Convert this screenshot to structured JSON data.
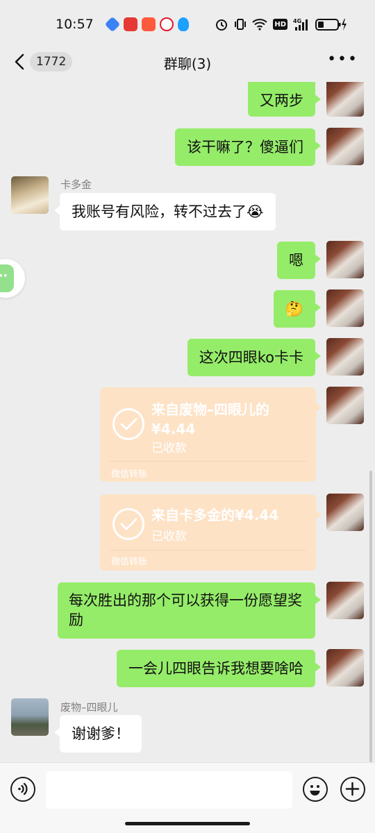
{
  "status_bar": {
    "time": "10:57",
    "hd_label": "HD",
    "network_label": "4G"
  },
  "header": {
    "back_count": "1772",
    "title": "群聊(3)",
    "more_label": "•••"
  },
  "messages": [
    {
      "side": "out",
      "text": "又两步"
    },
    {
      "side": "out",
      "text": "该干嘛了？傻逼们"
    },
    {
      "side": "in",
      "sender": "卡多金",
      "text": "我账号有风险，转不过去了😭"
    },
    {
      "side": "out",
      "text": "嗯"
    },
    {
      "side": "out",
      "text": "🤔"
    },
    {
      "side": "out",
      "text": "这次四眼ko卡卡"
    },
    {
      "side": "out",
      "type": "transfer",
      "title": "来自废物–四眼儿的",
      "amount": "¥4.44",
      "status": "已收款",
      "footer": "微信转账"
    },
    {
      "side": "out",
      "type": "transfer",
      "title": "来自卡多金的¥4.44",
      "status": "已收款",
      "footer": "微信转账"
    },
    {
      "side": "out",
      "text": "每次胜出的那个可以获得一份愿望奖励"
    },
    {
      "side": "out",
      "text": "一会儿四眼告诉我想要啥哈"
    },
    {
      "side": "in",
      "sender": "废物–四眼儿",
      "text": "谢谢爹！"
    }
  ],
  "colors": {
    "outgoing_bubble": "#95ec69",
    "incoming_bubble": "#ffffff",
    "transfer_card": "#fde2c6",
    "background": "#ededed"
  },
  "icons": {
    "voice": "voice-icon",
    "emoji": "emoji-icon",
    "add": "add-icon"
  }
}
